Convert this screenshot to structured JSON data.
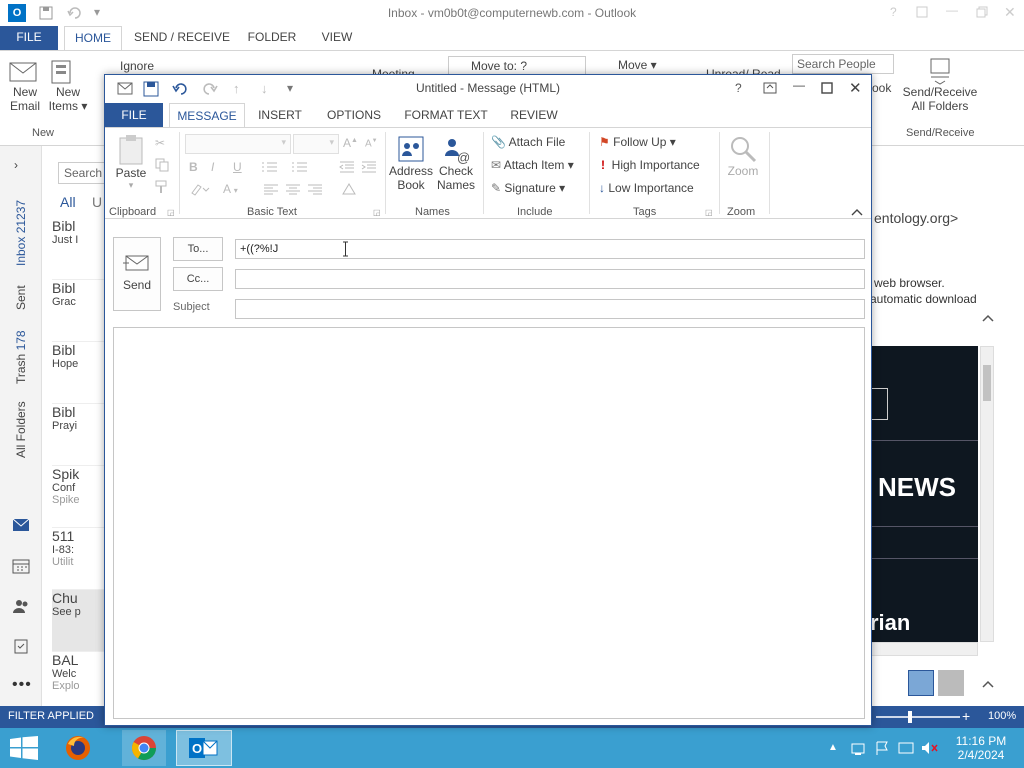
{
  "main_window": {
    "title": "Inbox - vm0b0t@computernewb.com - Outlook",
    "tabs": [
      "FILE",
      "HOME",
      "SEND / RECEIVE",
      "FOLDER",
      "VIEW"
    ],
    "active_tab": "HOME",
    "ribbon": {
      "new_email": [
        "New",
        "Email"
      ],
      "new_items": [
        "New",
        "Items ▾"
      ],
      "new_group": "New",
      "ignore": "Ignore",
      "meeting": "Meeting",
      "move_to": "Move to: ?",
      "move": "Move ▾",
      "unread_read": "Unread/ Read",
      "search_people": "Search People",
      "book": "ook",
      "send_receive": [
        "Send/Receive",
        "All Folders"
      ],
      "send_receive_group": "Send/Receive"
    },
    "nav": {
      "inbox_label": "Inbox",
      "inbox_count": "21237",
      "sent": "Sent",
      "trash_label": "Trash",
      "trash_count": "178",
      "all_folders": "All Folders"
    },
    "list": {
      "search_placeholder": "Search",
      "filter_all": "All",
      "filter_unread": "U",
      "items": [
        {
          "sender": "Bibl",
          "preview": "Just I",
          "sub": ""
        },
        {
          "sender": "Bibl",
          "preview": "Grac",
          "sub": ""
        },
        {
          "sender": "Bibl",
          "preview": "Hope",
          "sub": ""
        },
        {
          "sender": "Bibl",
          "preview": "Prayi",
          "sub": ""
        },
        {
          "sender": "Spik",
          "preview": "Conf",
          "sub": "Spike"
        },
        {
          "sender": "511",
          "preview": "I-83:",
          "sub": "Utilit"
        },
        {
          "sender": "Chu",
          "preview": "See p",
          "sub": ""
        },
        {
          "sender": "BAL",
          "preview": "Welc",
          "sub": "Explo"
        }
      ]
    },
    "reading": {
      "from_fragment": "entology.org>",
      "info_line1": "web browser.",
      "info_line2": "automatic download",
      "banner_news": "NEWS",
      "banner_rian": "rian"
    },
    "status": {
      "filter": "FILTER APPLIED",
      "zoom": "100%"
    }
  },
  "compose": {
    "title": "Untitled - Message (HTML)",
    "tabs": [
      "FILE",
      "MESSAGE",
      "INSERT",
      "OPTIONS",
      "FORMAT TEXT",
      "REVIEW"
    ],
    "active_tab": "MESSAGE",
    "ribbon": {
      "paste": "Paste",
      "clipboard": "Clipboard",
      "basic_text": "Basic Text",
      "address_book": [
        "Address",
        "Book"
      ],
      "check_names": [
        "Check",
        "Names"
      ],
      "names": "Names",
      "attach_file": "Attach File",
      "attach_item": "Attach Item ▾",
      "signature": "Signature ▾",
      "include": "Include",
      "follow_up": "Follow Up ▾",
      "high_importance": "High Importance",
      "low_importance": "Low Importance",
      "tags": "Tags",
      "zoom_btn": "Zoom",
      "zoom_group": "Zoom"
    },
    "send_label": "Send",
    "to_label": "To...",
    "to_value": "+((?%!J",
    "cc_label": "Cc...",
    "cc_value": "",
    "subject_label": "Subject",
    "subject_value": "",
    "body": ""
  },
  "taskbar": {
    "time": "11:16 PM",
    "date": "2/4/2024"
  },
  "colors": {
    "accent": "#2b579a",
    "taskbar": "#3a9fd0",
    "tab_active": "#2b579a"
  }
}
